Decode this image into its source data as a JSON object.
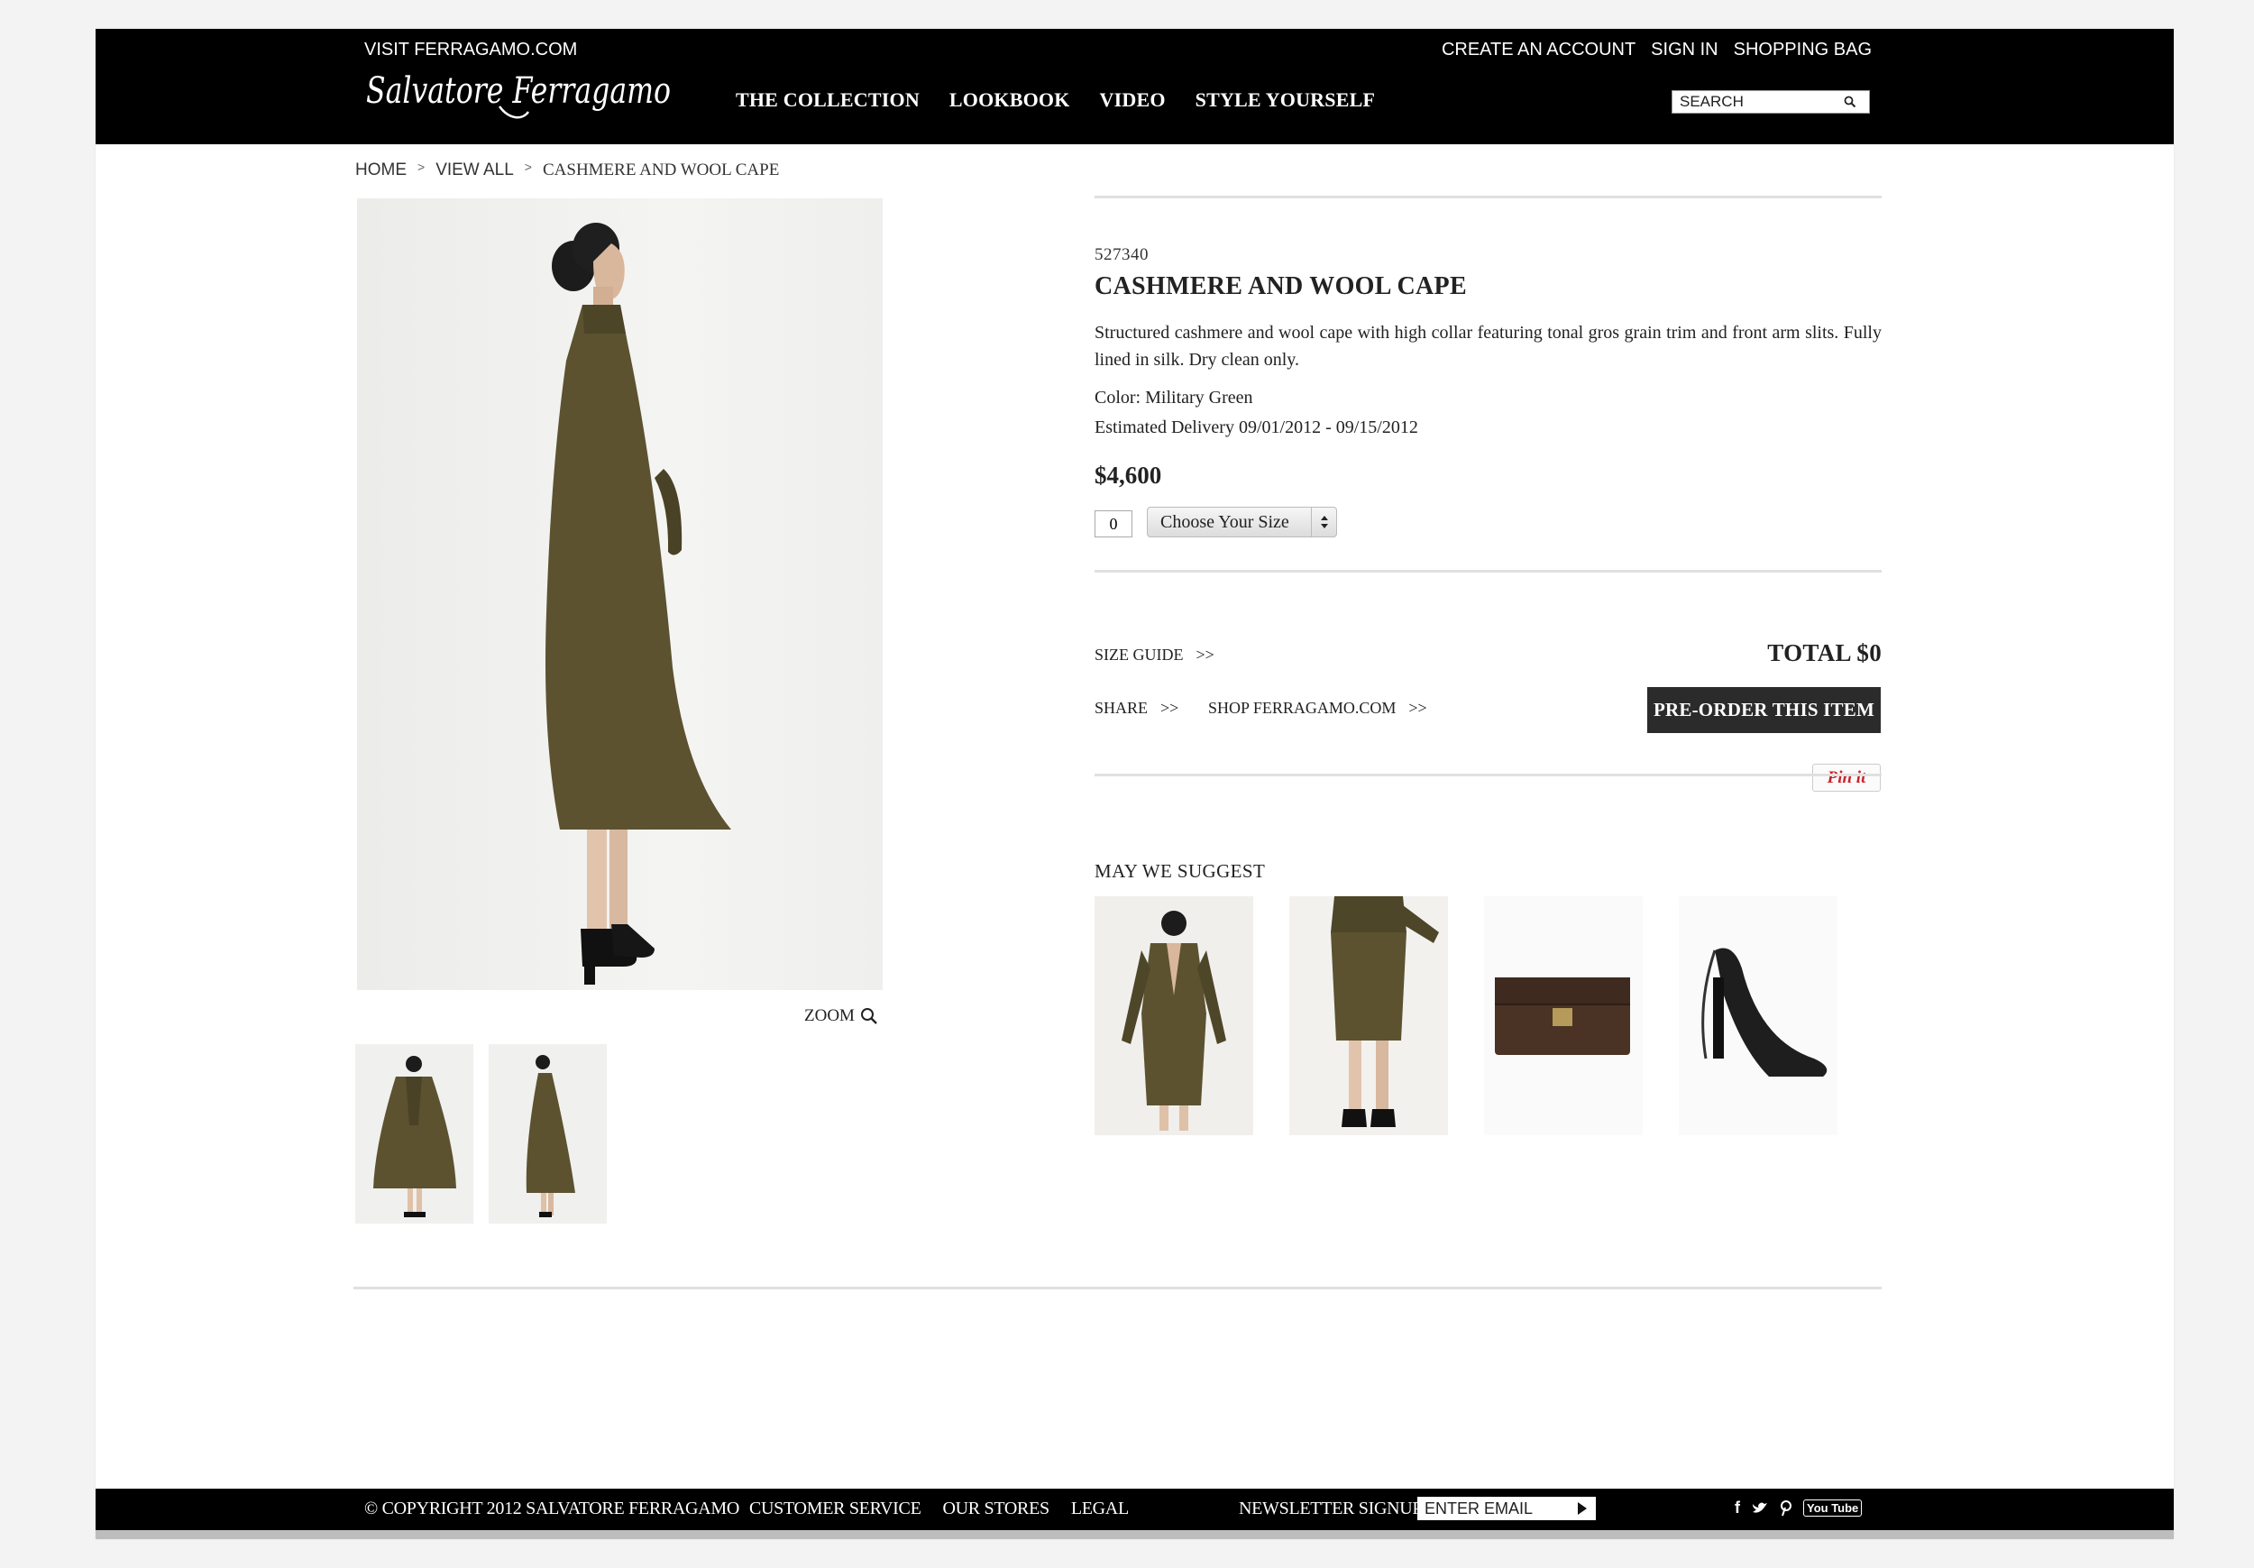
{
  "header": {
    "visit_link": "VISIT FERRAGAMO.COM",
    "brand": "Salvatore Ferragamo",
    "nav": [
      "THE COLLECTION",
      "LOOKBOOK",
      "VIDEO",
      "STYLE YOURSELF"
    ],
    "account_links": [
      "CREATE AN ACCOUNT",
      "SIGN IN",
      "SHOPPING BAG"
    ],
    "search_placeholder": "SEARCH"
  },
  "breadcrumb": {
    "home": "HOME",
    "view_all": "VIEW ALL",
    "current": "CASHMERE AND WOOL CAPE"
  },
  "gallery": {
    "zoom_label": "ZOOM"
  },
  "product": {
    "sku": "527340",
    "title": "CASHMERE AND WOOL CAPE",
    "description": "Structured cashmere and wool cape with high collar featuring tonal gros grain trim and front arm slits. Fully lined in silk. Dry clean only.",
    "color": "Color: Military Green",
    "delivery": "Estimated Delivery 09/01/2012 - 09/15/2012",
    "price": "$4,600",
    "quantity": "0",
    "size_select": "Choose Your Size",
    "size_guide": "SIZE GUIDE",
    "total": "TOTAL $0",
    "share": "SHARE",
    "shop": "SHOP FERRAGAMO.COM",
    "arrows": ">>",
    "preorder": "PRE-ORDER THIS ITEM",
    "pinit": "Pin it"
  },
  "suggest": {
    "heading": "MAY WE SUGGEST"
  },
  "footer": {
    "copyright": "© COPYRIGHT 2012 SALVATORE FERRAGAMO",
    "links": [
      "CUSTOMER SERVICE",
      "OUR STORES",
      "LEGAL"
    ],
    "newsletter": "NEWSLETTER SIGNUP",
    "email_placeholder": "ENTER EMAIL",
    "social": {
      "facebook": "f",
      "youtube": "You Tube"
    }
  },
  "colors": {
    "header_bg": "#000000",
    "button_bg": "#2b2b2b",
    "cape_green": "#5c5230",
    "pinit_red": "#cb2027"
  }
}
